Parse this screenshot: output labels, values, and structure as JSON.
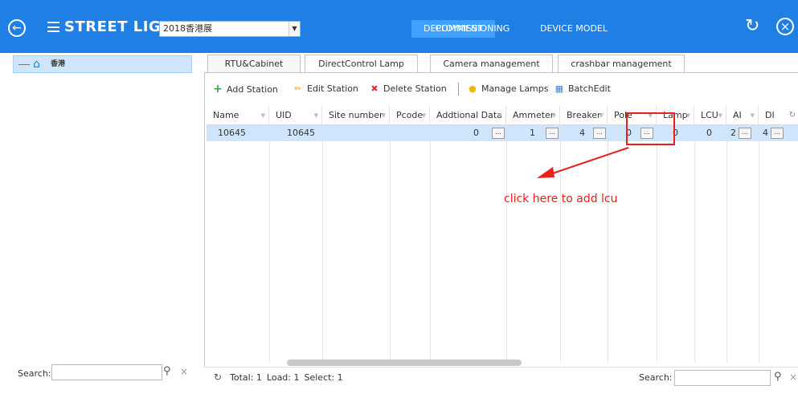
{
  "header": {
    "title": "STREET LIGHT",
    "project_selected": "2018香港展",
    "nav_tabs": [
      {
        "label": "DEPLOYMENT",
        "active": true
      },
      {
        "label": "COMMISSIONING",
        "active": false
      },
      {
        "label": "DEVICE MODEL",
        "active": false
      }
    ],
    "icons": {
      "back": "back-circle-icon",
      "menu": "menu-icon",
      "refresh": "refresh-icon",
      "close": "close-circle-icon"
    },
    "colors": {
      "brand": "#1f7fe5",
      "active_tab": "#3fa0ff"
    }
  },
  "left_panel": {
    "tree_root_label": "香港",
    "search_label": "Search:",
    "search_value": ""
  },
  "main": {
    "subtabs": [
      {
        "label": "RTU&Cabinet",
        "active": true
      },
      {
        "label": "DirectControl Lamp",
        "active": false
      },
      {
        "label": "Camera management",
        "active": false
      },
      {
        "label": "crashbar management",
        "active": false
      }
    ],
    "toolbar": {
      "add_station": "Add Station",
      "edit_station": "Edit Station",
      "delete_station": "Delete Station",
      "manage_lamps": "Manage Lamps",
      "batch_edit": "BatchEdit"
    },
    "grid": {
      "columns": [
        "Name",
        "UID",
        "Site number",
        "Pcode",
        "Addtional Data",
        "Ammeter",
        "Breaker",
        "Pole",
        "Lamp",
        "LCU",
        "AI",
        "DI"
      ],
      "row": {
        "name": "10645",
        "uid": "10645",
        "site_number": "",
        "pcode": "",
        "additional_data": "0",
        "ammeter": "1",
        "breaker": "4",
        "pole": "0",
        "lamp": "0",
        "lcu": "0",
        "ai": "2",
        "di": "4"
      },
      "cell_button_label": "...",
      "selected_row_color": "#cfe5fb"
    },
    "annotation": {
      "text": "click here to add lcu",
      "color": "#e8201c"
    },
    "footer": {
      "total": "Total: 1",
      "load": "Load: 1",
      "select": "Select: 1",
      "search_label": "Search:",
      "search_value": ""
    }
  }
}
